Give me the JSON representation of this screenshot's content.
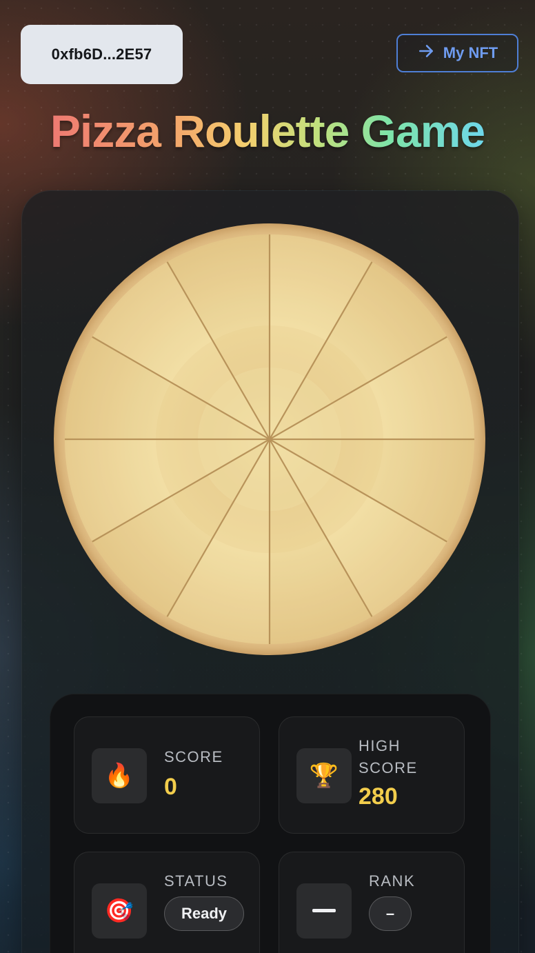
{
  "header": {
    "wallet_address": "0xfb6D...2E57",
    "nft_button_label": "My NFT",
    "nft_button_icon": "arrow-right-icon"
  },
  "title": "Pizza Roulette Game",
  "wheel": {
    "slices": 12,
    "colors": {
      "crust": "#e4c089",
      "slice_light": "#f4e4ad",
      "slice_dark": "#e6c98a",
      "cut_lines": "#b8935a"
    }
  },
  "stats": {
    "score": {
      "label": "SCORE",
      "value": "0",
      "icon": "fire-icon"
    },
    "high_score": {
      "label_line1": "HIGH",
      "label_line2": "SCORE",
      "value": "280",
      "icon": "trophy-icon"
    },
    "status": {
      "label": "STATUS",
      "value": "Ready",
      "icon": "target-icon"
    },
    "rank": {
      "label": "RANK",
      "value": "–",
      "icon": "dash-icon"
    }
  },
  "colors": {
    "accent_gold": "#f2cd4c",
    "button_blue": "#4f7fd6"
  }
}
